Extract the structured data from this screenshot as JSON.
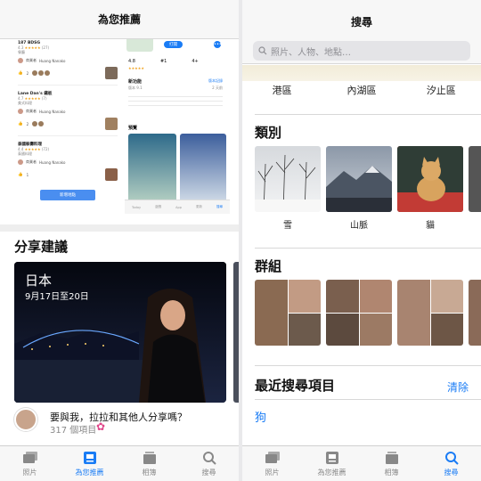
{
  "left": {
    "title": "為您推薦",
    "reviews": [
      {
        "name": "187 BDSG",
        "rating": "4.3",
        "count": "(27)",
        "category": "餐廳",
        "reviewer": "商業者",
        "poster": "Huang Nanako",
        "likes": "2"
      },
      {
        "name": "Lane Dan's 鐵板",
        "rating": "4.7",
        "count": "(7)",
        "category": "美式料理",
        "reviewer": "商業者",
        "poster": "Huang Nanako",
        "likes": "2"
      },
      {
        "name": "泰國躲壽料理",
        "rating": "4.4",
        "count": "(72)",
        "category": "泰國料理",
        "reviewer": "商業者",
        "poster": "Huang Nanako",
        "likes": "1"
      }
    ],
    "bottom_button": "新增地點",
    "app": {
      "get_label": "打開",
      "rating": "4.8",
      "rank": "#1",
      "age": "4+",
      "whats_new": "新功能",
      "version_history": "版本記錄",
      "version": "版本 9.1",
      "time_ago": "2 天前",
      "preview": "預覽",
      "tabs": [
        "Today",
        "遊戲",
        "App",
        "更新",
        "搜尋"
      ]
    },
    "share_title": "分享建議",
    "card": {
      "title": "日本",
      "dates": "9月17日至20日"
    },
    "share_prompt": "要與我，拉拉和其他人分享嗎？",
    "share_count": "317 個項目"
  },
  "right": {
    "title": "搜尋",
    "search_placeholder": "照片、人物、地點…",
    "places": [
      "港區",
      "內湖區",
      "汐止區"
    ],
    "categories_title": "類別",
    "categories": [
      "雪",
      "山脈",
      "貓"
    ],
    "groups_title": "群組",
    "recent_title": "最近搜尋項目",
    "clear_label": "清除",
    "recent_items": [
      "狗"
    ]
  },
  "tabbar": {
    "labels": [
      "照片",
      "為您推薦",
      "相簿",
      "搜尋"
    ]
  },
  "colors": {
    "accent": "#1a7cf5",
    "tabbar_bg": "#f7f7f7"
  }
}
